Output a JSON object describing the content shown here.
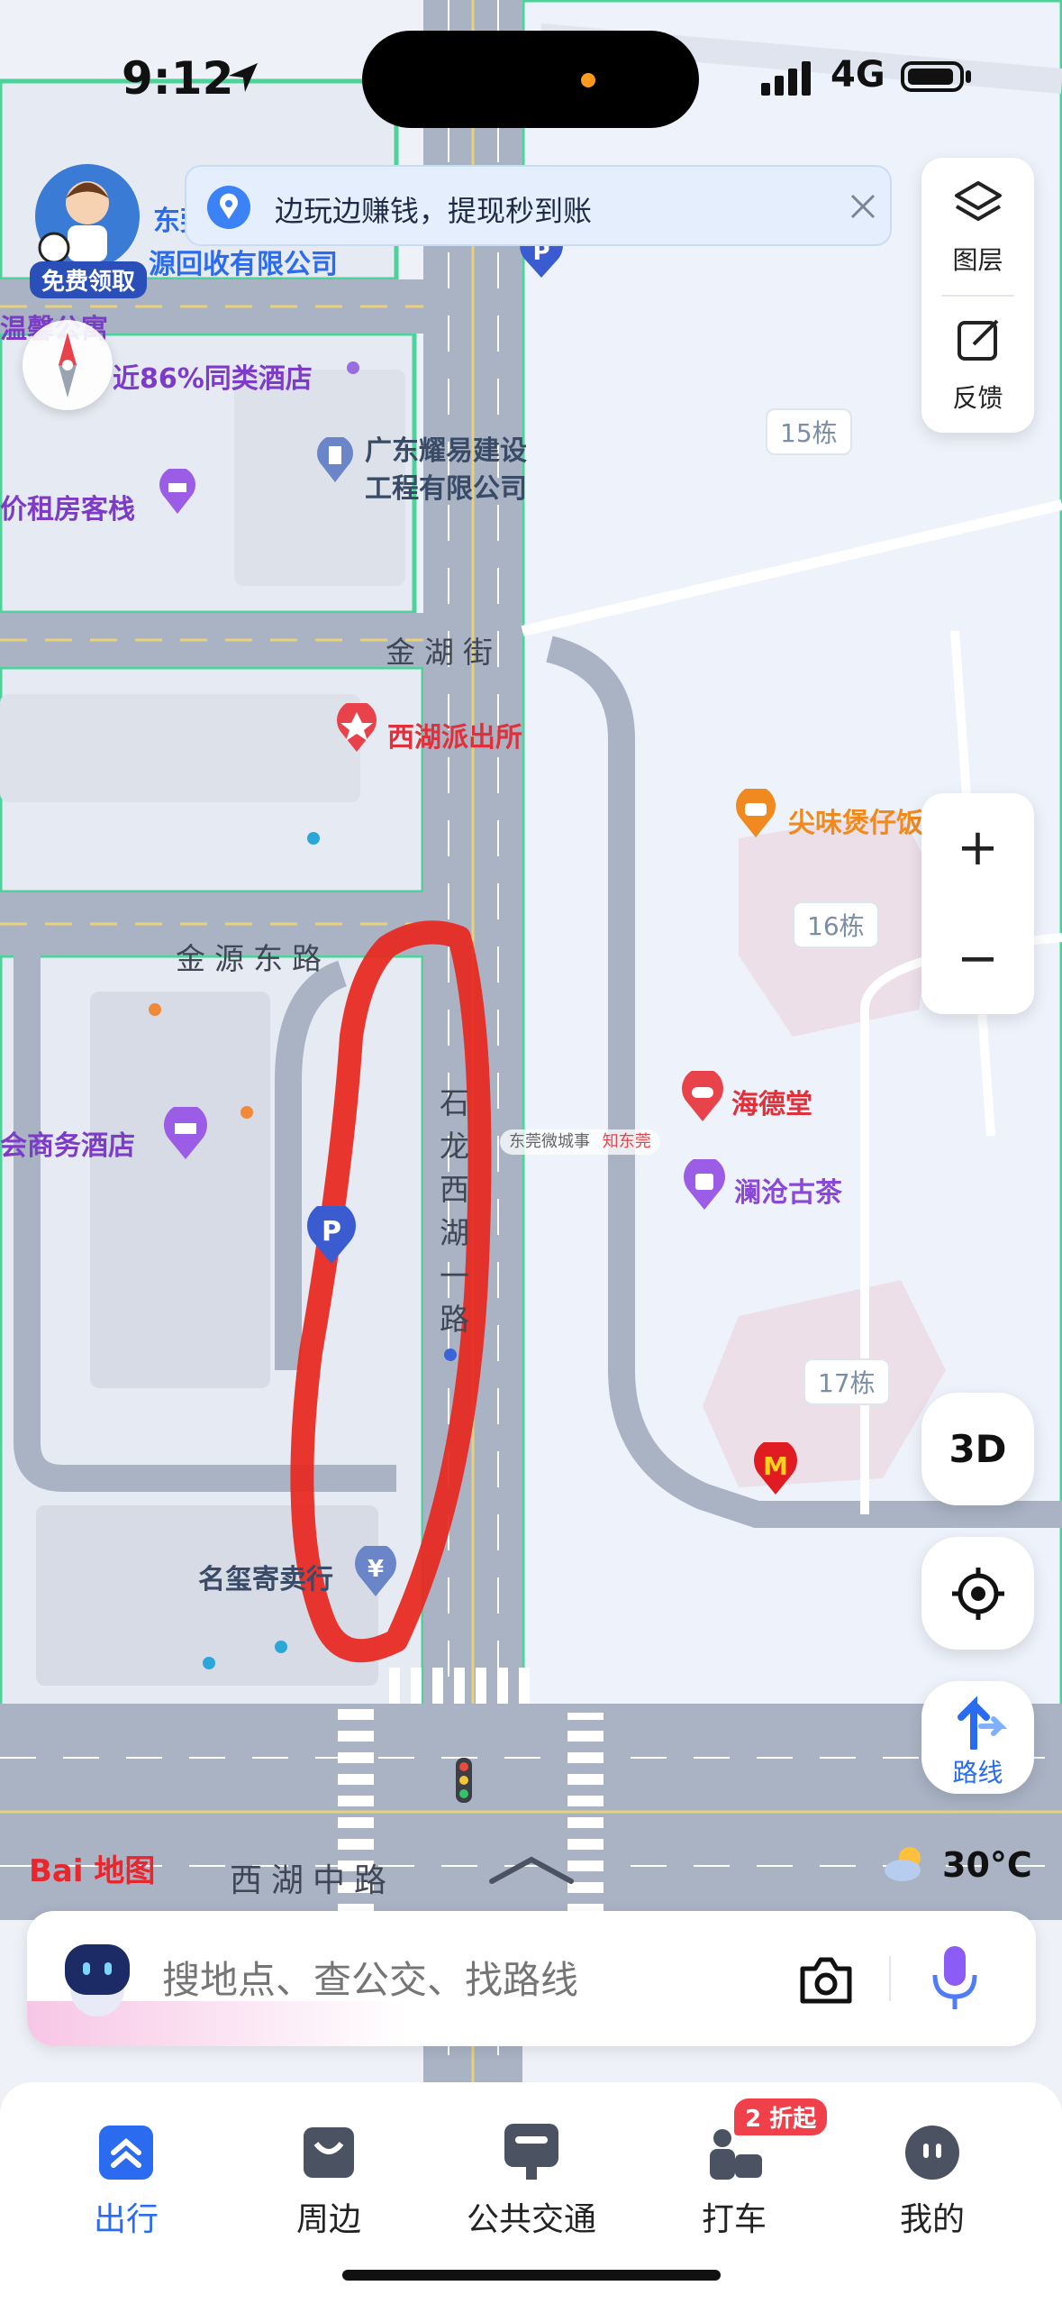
{
  "status_bar": {
    "time": "9:12",
    "network": "4G"
  },
  "promo_avatar": {
    "label": "免费领取"
  },
  "banner": {
    "text": "边玩边赚钱，提现秒到账"
  },
  "controls": {
    "layers_label": "图层",
    "feedback_label": "反馈",
    "zoom_in": "+",
    "zoom_out": "−",
    "three_d": "3D",
    "route_label": "路线",
    "weather": "30°C"
  },
  "map": {
    "roads": [
      "金湖街",
      "金源东路",
      "西湖中路",
      "石龙西湖一路"
    ],
    "buildings": [
      "15栋",
      "16栋",
      "17栋"
    ],
    "pois": [
      "东莞",
      "源回收有限公司",
      "温馨公寓",
      "近86%同类酒店",
      "广东耀易建设",
      "工程有限公司",
      "价租房客栈",
      "西湖派出所",
      "尖味煲仔饭",
      "会商务酒店",
      "海德堂",
      "澜沧古茶",
      "名玺寄卖行"
    ],
    "watermark_1": "东莞微城事",
    "watermark_2": "知东莞"
  },
  "logo": {
    "text": "Bai 地图"
  },
  "search": {
    "placeholder": "搜地点、查公交、找路线"
  },
  "tabs": [
    {
      "label": "出行",
      "active": true
    },
    {
      "label": "周边"
    },
    {
      "label": "公共交通"
    },
    {
      "label": "打车",
      "badge": "2 折起"
    },
    {
      "label": "我的"
    }
  ],
  "colors": {
    "accent": "#2a6bf0",
    "road": "#a9b3c4",
    "green_edge": "#4cd39a",
    "annotation": "#e8261e"
  }
}
